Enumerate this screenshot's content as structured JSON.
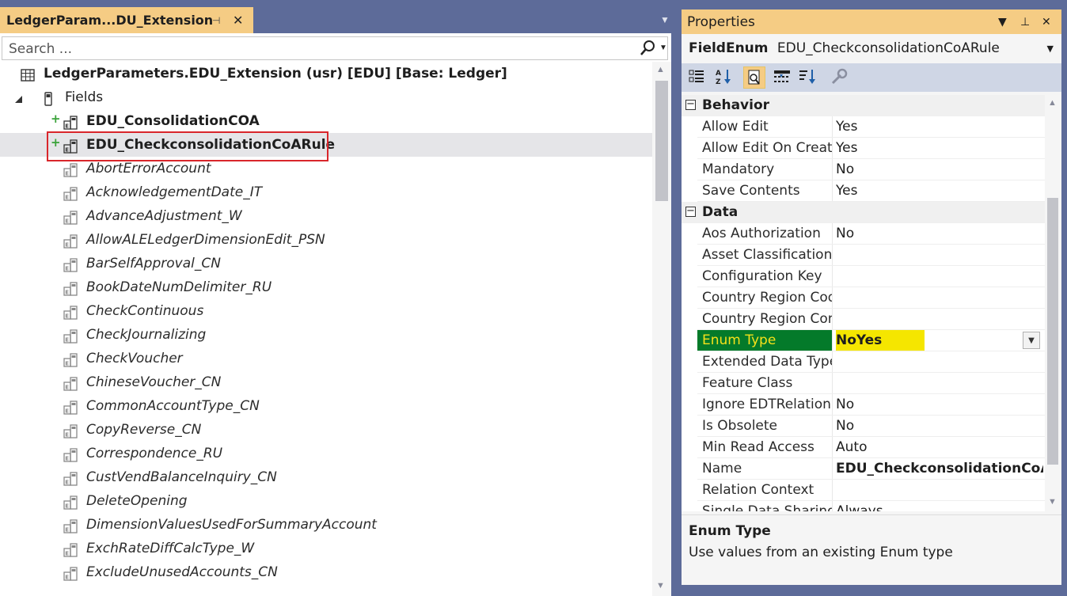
{
  "left_tab": {
    "title": "LedgerParam...DU_Extension",
    "pin": "⊣",
    "close": "✕"
  },
  "search": {
    "placeholder": "Search ..."
  },
  "tree": {
    "root": "LedgerParameters.EDU_Extension (usr) [EDU] [Base: Ledger]",
    "fields_node": "Fields",
    "new_fields": [
      "EDU_ConsolidationCOA",
      "EDU_CheckconsolidationCoARule"
    ],
    "fields": [
      "AbortErrorAccount",
      "AcknowledgementDate_IT",
      "AdvanceAdjustment_W",
      "AllowALELedgerDimensionEdit_PSN",
      "BarSelfApproval_CN",
      "BookDateNumDelimiter_RU",
      "CheckContinuous",
      "CheckJournalizing",
      "CheckVoucher",
      "ChineseVoucher_CN",
      "CommonAccountType_CN",
      "CopyReverse_CN",
      "Correspondence_RU",
      "CustVendBalanceInquiry_CN",
      "DeleteOpening",
      "DimensionValuesUsedForSummaryAccount",
      "ExchRateDiffCalcType_W",
      "ExcludeUnusedAccounts_CN"
    ],
    "added_marker": "+"
  },
  "properties": {
    "header": "Properties",
    "object_type": "FieldEnum",
    "object_name": "EDU_CheckconsolidationCoARule",
    "categories": [
      {
        "name": "Behavior",
        "toggle": "−",
        "rows": [
          {
            "name": "Allow Edit",
            "value": "Yes"
          },
          {
            "name": "Allow Edit On Create",
            "value": "Yes"
          },
          {
            "name": "Mandatory",
            "value": "No"
          },
          {
            "name": "Save Contents",
            "value": "Yes"
          }
        ]
      },
      {
        "name": "Data",
        "toggle": "−",
        "rows": [
          {
            "name": "Aos Authorization",
            "value": "No"
          },
          {
            "name": "Asset Classification",
            "value": ""
          },
          {
            "name": "Configuration Key",
            "value": ""
          },
          {
            "name": "Country Region Codes",
            "value": ""
          },
          {
            "name": "Country Region Context Fields",
            "value": ""
          },
          {
            "name": "Enum Type",
            "value": "NoYes",
            "selected": true
          },
          {
            "name": "Extended Data Type",
            "value": ""
          },
          {
            "name": "Feature Class",
            "value": ""
          },
          {
            "name": "Ignore EDTRelation",
            "value": "No"
          },
          {
            "name": "Is Obsolete",
            "value": "No"
          },
          {
            "name": "Min Read Access",
            "value": "Auto"
          },
          {
            "name": "Name",
            "value": "EDU_CheckconsolidationCoARule",
            "bold": true
          },
          {
            "name": "Relation Context",
            "value": ""
          },
          {
            "name": "Single Data Sharing Field",
            "value": "Always"
          }
        ]
      }
    ],
    "description": {
      "title": "Enum Type",
      "text": "Use values from an existing Enum type"
    }
  },
  "colors": {
    "tab_active": "#f5cc84",
    "frame": "#5d6b99",
    "selected_name_bg": "#047a2a",
    "selected_value_bg": "#f5e600",
    "highlight_border": "#d9262b"
  }
}
